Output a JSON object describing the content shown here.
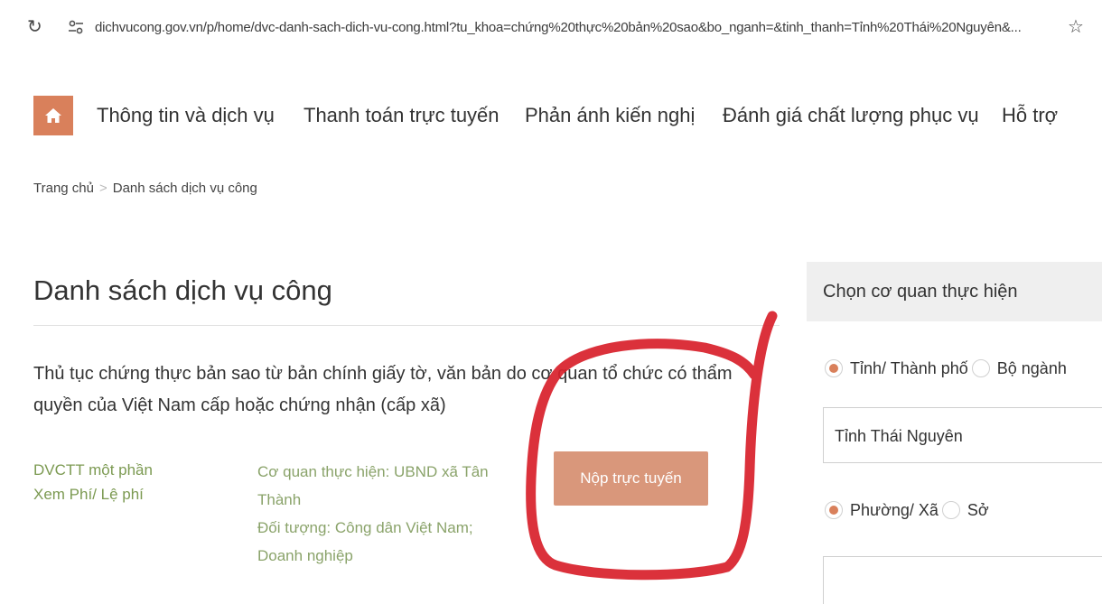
{
  "browser": {
    "url": "dichvucong.gov.vn/p/home/dvc-danh-sach-dich-vu-cong.html?tu_khoa=chứng%20thực%20bản%20sao&bo_nganh=&tinh_thanh=Tỉnh%20Thái%20Nguyên&..."
  },
  "topnav": {
    "items": [
      "Thông tin và dịch vụ",
      "Thanh toán trực tuyến",
      "Phản ánh kiến nghị",
      "Đánh giá chất lượng phục vụ",
      "Hỗ trợ"
    ]
  },
  "breadcrumb": {
    "home": "Trang chủ",
    "separator": ">",
    "current": "Danh sách dịch vụ công"
  },
  "main": {
    "title": "Danh sách dịch vụ công",
    "procedure": {
      "title": "Thủ tục chứng thực bản sao từ bản chính giấy tờ, văn bản do cơ quan tổ chức có thẩm quyền của Việt Nam cấp hoặc chứng nhận (cấp xã)",
      "level": "DVCTT một phần",
      "fee_link": "Xem Phí/ Lệ phí",
      "agency": "Cơ quan thực hiện: UBND xã Tân Thành",
      "subjects": "Đối tượng: Công dân Việt Nam; Doanh nghiệp",
      "submit_label": "Nộp trực tuyến"
    }
  },
  "sidebar": {
    "heading": "Chọn cơ quan thực hiện",
    "scope_options": [
      "Tỉnh/ Thành phố",
      "Bộ ngành"
    ],
    "scope_selected": "Tỉnh/ Thành phố",
    "province_value": "Tỉnh Thái Nguyên",
    "unit_options": [
      "Phường/ Xã",
      "Sở"
    ],
    "unit_selected": "Phường/ Xã",
    "unit_value": ""
  },
  "colors": {
    "accent": "#d9805b",
    "button": "#d9977b",
    "meta_text": "#7c9a52",
    "annotation": "#d8202a"
  }
}
